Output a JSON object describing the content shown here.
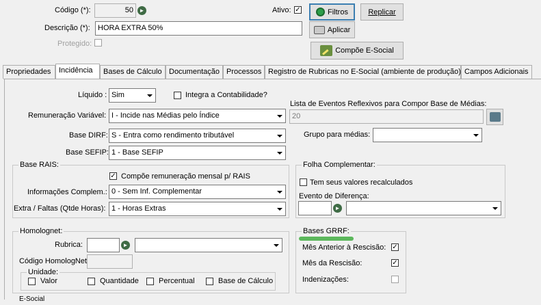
{
  "header": {
    "codigo_label": "Código (*):",
    "codigo_value": "50",
    "descricao_label": "Descrição (*):",
    "descricao_value": "HORA EXTRA 50%",
    "protegido_label": "Protegido:",
    "ativo_label": "Ativo:",
    "ativo_checked": "✓",
    "filtros_label": "Filtros",
    "replicar_label": "Replicar",
    "aplicar_label": "Aplicar",
    "compoe_label": "Compõe E-Social"
  },
  "tabs": [
    {
      "label": "Propriedades"
    },
    {
      "label": "Incidência"
    },
    {
      "label": "Bases de Cálculo"
    },
    {
      "label": "Documentação"
    },
    {
      "label": "Processos"
    },
    {
      "label": "Registro de Rubricas no E-Social (ambiente de produção)"
    },
    {
      "label": "Campos Adicionais"
    }
  ],
  "incidencia": {
    "liquido_label": "Líquido :",
    "liquido_value": "Sim",
    "integra_label": "Integra a Contabilidade?",
    "rem_var_label": "Remuneração Variável:",
    "rem_var_value": "I - Incide nas Médias pelo Índice",
    "lista_eventos_label": "Lista de Eventos Reflexivos para Compor Base de Médias:",
    "lista_eventos_value": "20",
    "base_dirf_label": "Base DIRF:",
    "base_dirf_value": "S - Entra como rendimento tributável",
    "grupo_medias_label": "Grupo para médias:",
    "grupo_medias_value": "",
    "base_sefip_label": "Base SEFIP:",
    "base_sefip_value": "1 - Base SEFIP"
  },
  "base_rais": {
    "title": "Base RAIS:",
    "compoe_label": "Compõe remuneração mensal p/ RAIS",
    "compoe_checked": "✓",
    "info_label": "Informações Complem.:",
    "info_value": "0 - Sem Inf. Complementar",
    "extra_label": "Extra / Faltas (Qtde Horas):",
    "extra_value": "1 - Horas Extras"
  },
  "folha_comp": {
    "title": "Folha Complementar:",
    "recalc_label": "Tem seus valores recalculados",
    "evento_label": "Evento de Diferença:"
  },
  "homolognet": {
    "title": "Homolognet:",
    "rubrica_label": "Rubrica:",
    "codigo_label": "Código HomologNet",
    "unidade_title": "Unidade:",
    "valor_label": "Valor",
    "quantidade_label": "Quantidade",
    "percentual_label": "Percentual",
    "base_calc_label": "Base de Cálculo"
  },
  "bases_grrf": {
    "title": "Bases GRRF:",
    "mes_anterior_label": "Mês Anterior à Rescisão:",
    "mes_anterior_checked": "✓",
    "mes_rescisao_label": "Mês da Rescisão:",
    "mes_rescisao_checked": "✓",
    "indenizacoes_label": "Indenizações:"
  },
  "footer": {
    "partial_label": "E-Social"
  },
  "colors": {
    "highlight": "#5cb85c",
    "icon_green": "#3f6b45"
  }
}
